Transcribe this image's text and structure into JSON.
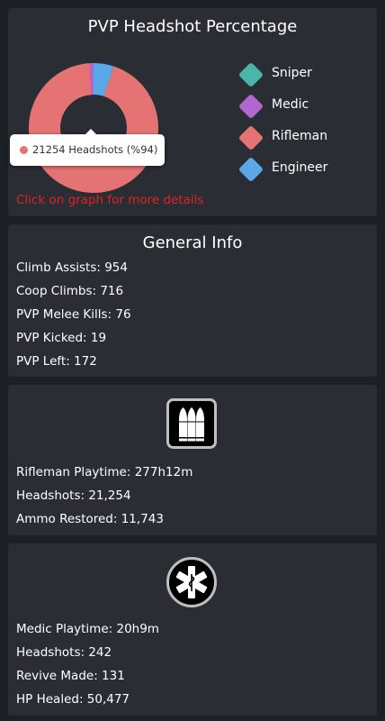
{
  "pvp": {
    "title": "PVP Headshot Percentage",
    "tooltip": "21254 Headshots (%94)",
    "hint": "Click on graph for more details",
    "hint_color": "#e0231f",
    "legend": [
      {
        "label": "Sniper",
        "color": "#4bb5a8"
      },
      {
        "label": "Medic",
        "color": "#b068d0"
      },
      {
        "label": "Rifleman",
        "color": "#e67373"
      },
      {
        "label": "Engineer",
        "color": "#5aa8e8"
      }
    ]
  },
  "chart_data": {
    "type": "pie",
    "categories": [
      "Sniper",
      "Medic",
      "Rifleman",
      "Engineer"
    ],
    "values": [
      0,
      1,
      94,
      5
    ],
    "colors": [
      "#4bb5a8",
      "#b068d0",
      "#e67373",
      "#5aa8e8"
    ],
    "title": "PVP Headshot Percentage"
  },
  "general": {
    "title": "General Info",
    "stats": [
      "Climb Assists: 954",
      "Coop Climbs: 716",
      "PVP Melee Kills: 76",
      "PVP Kicked: 19",
      "PVP Left: 172"
    ]
  },
  "rifleman": {
    "icon": "ammo-icon",
    "stats": [
      "Rifleman Playtime: 277h12m",
      "Headshots: 21,254",
      "Ammo Restored: 11,743"
    ]
  },
  "medic": {
    "icon": "medic-cross-icon",
    "stats": [
      "Medic Playtime: 20h9m",
      "Headshots: 242",
      "Revive Made: 131",
      "HP Healed: 50,477"
    ]
  }
}
